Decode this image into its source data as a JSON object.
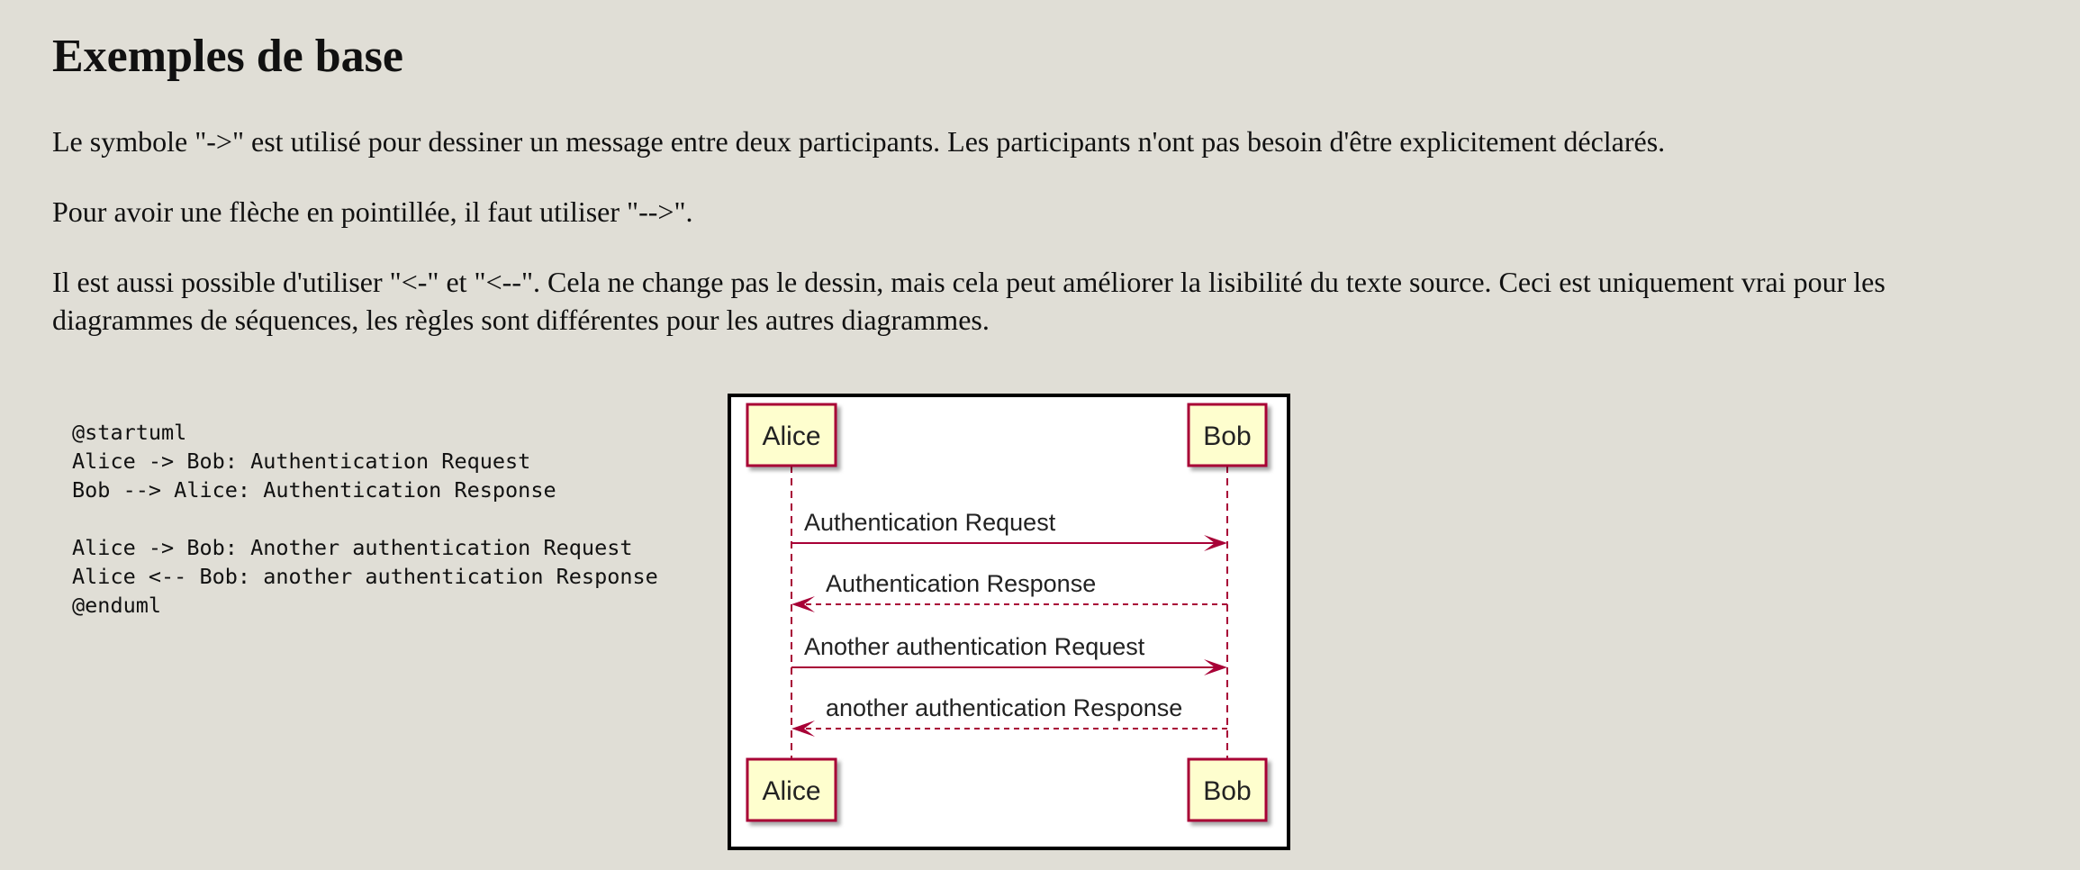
{
  "heading": "Exemples de base",
  "paragraphs": [
    "Le symbole \"->\" est utilisé pour dessiner un message entre deux participants. Les participants n'ont pas besoin d'être explicitement déclarés.",
    "Pour avoir une flèche en pointillée, il faut utiliser \"-->\".",
    "Il est aussi possible d'utiliser \"<-\" et \"<--\". Cela ne change pas le dessin, mais cela peut améliorer la lisibilité du texte source. Ceci est uniquement vrai pour les diagrammes de séquences, les règles sont différentes pour les autres diagrammes."
  ],
  "code_lines": [
    "@startuml",
    "Alice -> Bob: Authentication Request",
    "Bob --> Alice: Authentication Response",
    "",
    "Alice -> Bob: Another authentication Request",
    "Alice <-- Bob: another authentication Response",
    "@enduml"
  ],
  "diagram": {
    "participants": [
      "Alice",
      "Bob"
    ],
    "messages": [
      {
        "text": "Authentication Request",
        "from": "Alice",
        "to": "Bob",
        "style": "solid"
      },
      {
        "text": "Authentication Response",
        "from": "Bob",
        "to": "Alice",
        "style": "dashed"
      },
      {
        "text": "Another authentication Request",
        "from": "Alice",
        "to": "Bob",
        "style": "solid"
      },
      {
        "text": "another authentication Response",
        "from": "Bob",
        "to": "Alice",
        "style": "dashed"
      }
    ],
    "colors": {
      "participant_fill": "#fefece",
      "participant_border": "#a80036",
      "lifeline": "#a80036",
      "arrow": "#a80036"
    }
  }
}
